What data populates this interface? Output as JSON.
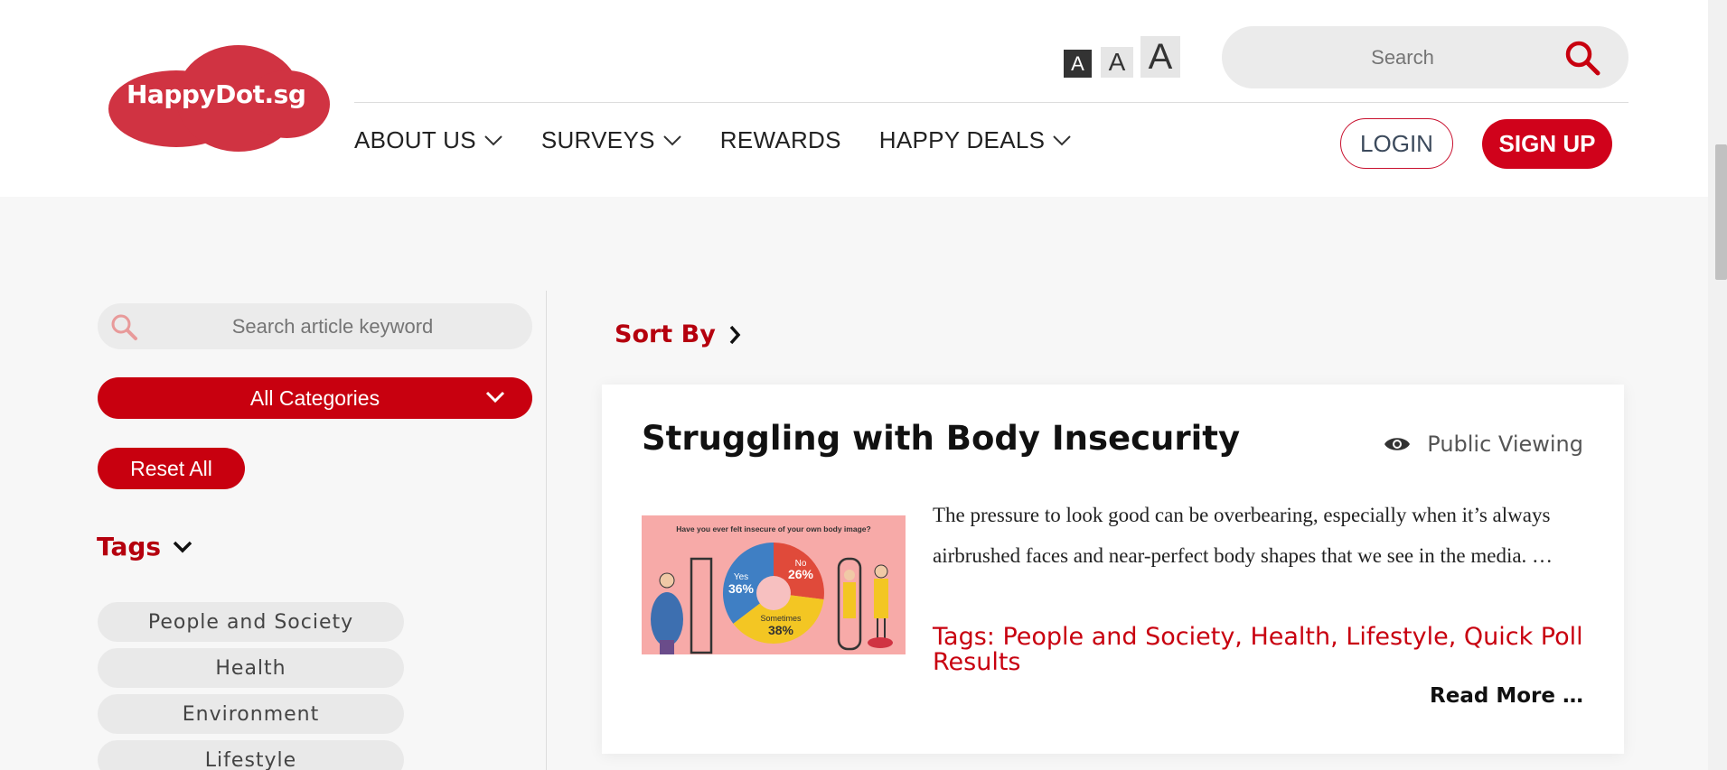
{
  "header": {
    "logo_text": "HappyDot.sg",
    "font_size_controls": [
      "A",
      "A",
      "A"
    ],
    "search_placeholder": "Search",
    "nav": [
      {
        "label": "ABOUT US",
        "has_dropdown": true
      },
      {
        "label": "SURVEYS",
        "has_dropdown": true
      },
      {
        "label": "REWARDS",
        "has_dropdown": false
      },
      {
        "label": "HAPPY DEALS",
        "has_dropdown": true
      }
    ],
    "login_label": "LOGIN",
    "signup_label": "SIGN UP"
  },
  "sidebar": {
    "search_placeholder": "Search article keyword",
    "categories_label": "All Categories",
    "reset_label": "Reset All",
    "tags_heading": "Tags",
    "tags": [
      "People and Society",
      "Health",
      "Environment",
      "Lifestyle"
    ]
  },
  "main": {
    "sort_by_label": "Sort By",
    "article": {
      "title": "Struggling with Body Insecurity",
      "visibility": "Public Viewing",
      "excerpt": "The pressure to look good can be overbearing, especially when it’s always airbrushed faces and near-perfect body shapes that we see in the media. …",
      "tags_line": "Tags: People and Society, Health, Lifestyle, Quick Poll Results",
      "read_more": "Read More …",
      "thumbnail": {
        "question": "Have you ever felt insecure of your own body image?",
        "slices": [
          {
            "label": "Yes",
            "value": "36%",
            "color": "#3f7fc4"
          },
          {
            "label": "No",
            "value": "26%",
            "color": "#e04a3a"
          },
          {
            "label": "Sometimes",
            "value": "38%",
            "color": "#f3c623"
          }
        ]
      }
    }
  },
  "colors": {
    "brand_red": "#c8000f",
    "logo_red": "#d03342"
  }
}
